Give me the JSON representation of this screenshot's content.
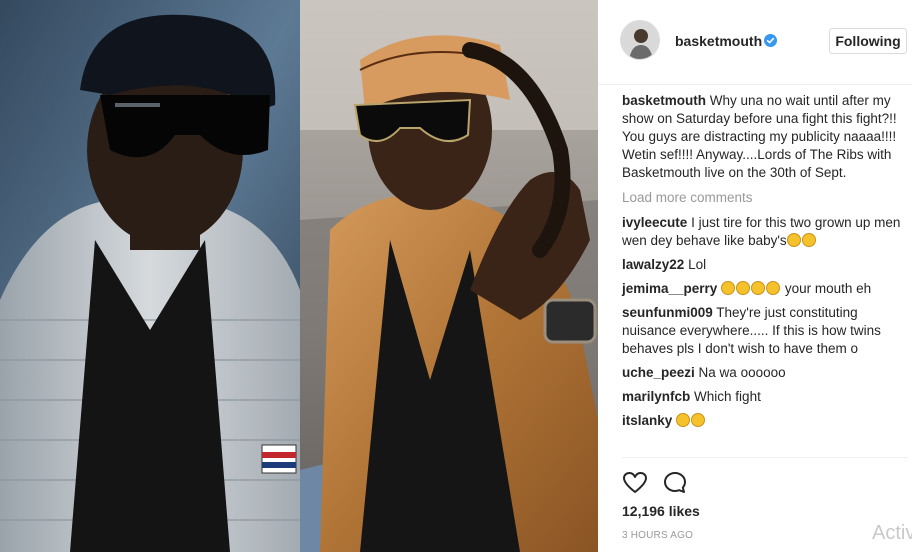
{
  "post": {
    "username": "basketmouth",
    "follow_label": "Following",
    "caption_user": "basketmouth",
    "caption_text": "Why una no wait until after my show on Saturday before una fight this fight?!! You guys are distracting my publicity naaaa!!!! Wetin sef!!!! Anyway....Lords of The Ribs with Basketmouth live on the 30th of Sept.",
    "load_more": "Load more comments",
    "likes": "12,196 likes",
    "time": "3 HOURS AGO"
  },
  "comments": [
    {
      "user": "ivyleecute",
      "text": "I just tire for this two grown up men wen dey behave like baby's",
      "emoji": [
        "pensive",
        "pensive"
      ]
    },
    {
      "user": "lawalzy22",
      "text": "Lol"
    },
    {
      "user": "jemima__perry",
      "text": "your mouth eh",
      "emoji_before": [
        "grin",
        "grin",
        "grin",
        "grin"
      ]
    },
    {
      "user": "seunfunmi009",
      "text": "They're just constituting nuisance everywhere..... If this is how twins behaves pls I don't wish to have them o"
    },
    {
      "user": "uche_peezi",
      "text": "Na wa oooooo"
    },
    {
      "user": "marilynfcb",
      "text": "Which fight"
    },
    {
      "user": "itslanky",
      "text": "",
      "emoji": [
        "grin",
        "grin"
      ]
    }
  ],
  "icons": {
    "verified": "verified-badge-icon",
    "like": "heart-icon",
    "comment": "comment-bubble-icon"
  },
  "colors": {
    "verified": "#3897f0",
    "text": "#262626",
    "muted": "#999999",
    "border": "#dbdbdb"
  },
  "watermark": "Activ"
}
